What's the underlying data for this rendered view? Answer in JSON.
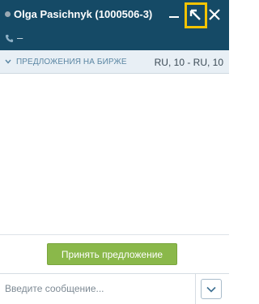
{
  "header": {
    "title": "Olga Pasichnyk (1000506-3)",
    "phone": "–",
    "icons": [
      "status-dot",
      "minimize-icon",
      "expand-icon",
      "close-icon",
      "phone-icon"
    ]
  },
  "offer_bar": {
    "label": "ПРЕДЛОЖЕНИЯ НА БИРЖЕ",
    "value": "RU, 10 - RU, 10"
  },
  "footer": {
    "accept_label": "Принять предложение"
  },
  "composer": {
    "placeholder": "Введите сообщение..."
  },
  "colors": {
    "header_bg": "#154a66",
    "highlight": "#f3c300",
    "accept_bg": "#8ab84a",
    "offer_bar_bg": "#e8eff5",
    "offer_label": "#5a86a3"
  }
}
